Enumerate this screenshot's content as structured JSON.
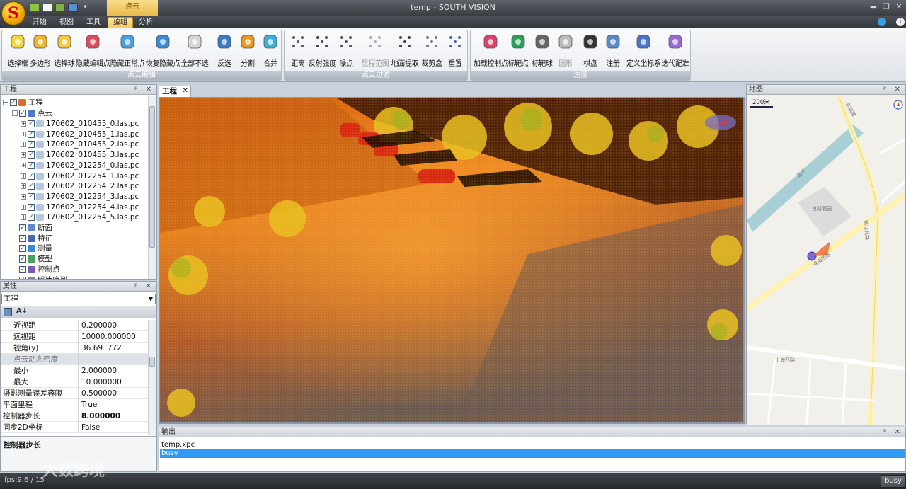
{
  "window": {
    "title": "temp - SOUTH VISION",
    "logo_letter": "S"
  },
  "ribbon_tabs": [
    {
      "label": "开始"
    },
    {
      "label": "视图"
    },
    {
      "label": "工具"
    },
    {
      "label": "编辑",
      "active": true
    },
    {
      "label": "分析"
    }
  ],
  "context_tab": "点云",
  "groups": {
    "edit": {
      "label": "点云编辑",
      "buttons": [
        "选择框",
        "多边形",
        "选择球",
        "隐藏编辑点",
        "隐藏正常点",
        "恢复隐藏点",
        "全部不选",
        "反选",
        "分割",
        "合并"
      ]
    },
    "filter": {
      "label": "点云过滤",
      "buttons": [
        "距离",
        "反射强度",
        "噪点",
        "里程范围",
        "地面提取",
        "裁剪盒",
        "重置"
      ]
    },
    "register": {
      "label": "注册",
      "buttons": [
        "加载控制点",
        "标靶点",
        "标靶球",
        "圆形",
        "棋盘",
        "注册",
        "定义坐标系",
        "迭代配准"
      ]
    }
  },
  "project_panel": {
    "title": "工程",
    "root": "工程",
    "cloud_node": "点云",
    "files": [
      "170602_010455_0.las.pc",
      "170602_010455_1.las.pc",
      "170602_010455_2.las.pc",
      "170602_010455_3.las.pc",
      "170602_012254_0.las.pc",
      "170602_012254_1.las.pc",
      "170602_012254_2.las.pc",
      "170602_012254_3.las.pc",
      "170602_012254_4.las.pc",
      "170602_012254_5.las.pc"
    ],
    "other_nodes": [
      "断面",
      "特征",
      "测量",
      "模型",
      "控制点",
      "照片序列"
    ]
  },
  "props_panel": {
    "title": "属性",
    "object": "工程",
    "rows": [
      {
        "k": "近视距",
        "v": "0.200000"
      },
      {
        "k": "远视距",
        "v": "10000.000000"
      },
      {
        "k": "视角(y)",
        "v": "36.691772"
      },
      {
        "k": "点云动态密度",
        "v": "",
        "cat": true
      },
      {
        "k": "最小",
        "v": "2.000000"
      },
      {
        "k": "最大",
        "v": "10.000000"
      },
      {
        "k": "摄影测量误差容限",
        "v": "0.500000"
      },
      {
        "k": "平面里程",
        "v": "True"
      },
      {
        "k": "控制器步长",
        "v": "8.000000",
        "bold": true
      },
      {
        "k": "同步2D坐标",
        "v": "False"
      }
    ],
    "description_title": "控制器步长"
  },
  "view_tab": "工程",
  "map_panel": {
    "title": "地图",
    "scale": "200米",
    "labels": [
      "东城路",
      "运河",
      "良耕润园",
      "镇江北路",
      "淮海西路",
      "上海西路"
    ]
  },
  "output_panel": {
    "title": "输出",
    "lines": [
      "temp.xpc",
      "busy"
    ]
  },
  "status": {
    "fps": "fps:9.6 / 15",
    "busy": "busy",
    "watermark": "大数跨境"
  }
}
